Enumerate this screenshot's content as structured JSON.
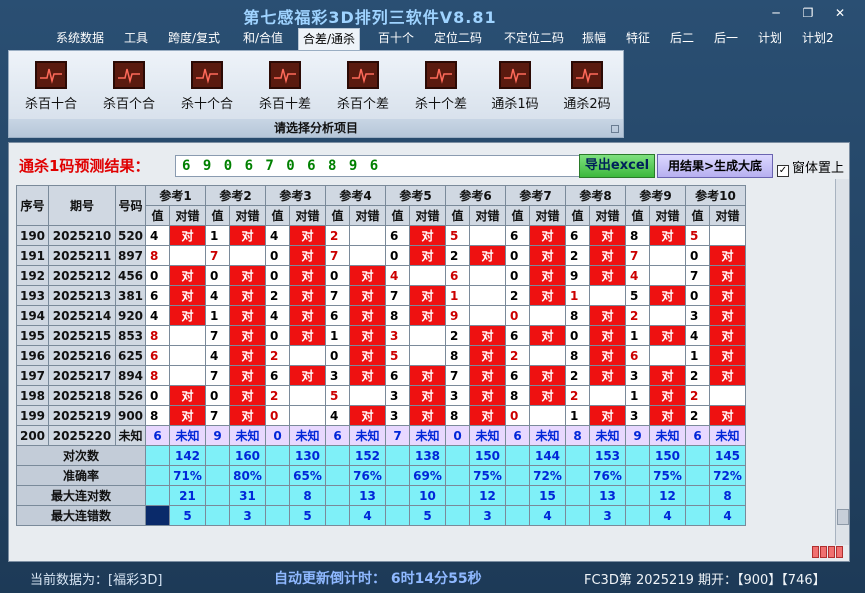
{
  "window": {
    "title": "第七感福彩3D排列三软件V8.81",
    "min": "─",
    "restore": "❐",
    "close": "✕"
  },
  "menu": [
    "系统数据",
    "工具",
    "跨度/复式",
    "和/合值",
    "合差/通杀",
    "百十个",
    "定位二码",
    "不定位二码",
    "振幅",
    "特征",
    "后二",
    "后一",
    "计划",
    "计划2"
  ],
  "menu_active": 4,
  "ribbon": {
    "buttons": [
      "杀百十合",
      "杀百个合",
      "杀十个合",
      "杀百十差",
      "杀百个差",
      "杀十个差",
      "通杀1码",
      "通杀2码"
    ],
    "caption": "请选择分析项目"
  },
  "prediction": {
    "label": "通杀1码预测结果：",
    "value": "6 9 0 6 7 0 6 8 9 6",
    "export_label": "导出excel",
    "generate_label": "用结果>生成大底",
    "topmost_label": "窗体置上"
  },
  "table": {
    "headers": {
      "seq": "序号",
      "period": "期号",
      "code": "号码",
      "refs": [
        "参考1",
        "参考2",
        "参考3",
        "参考4",
        "参考5",
        "参考6",
        "参考7",
        "参考8",
        "参考9",
        "参考10"
      ],
      "val": "值",
      "res": "对错"
    },
    "rows": [
      {
        "seq": "190",
        "period": "2025210",
        "code": "520",
        "vals": [
          "4",
          "1",
          "4",
          "2",
          "6",
          "5",
          "6",
          "6",
          "8",
          "5"
        ],
        "hits": [
          1,
          1,
          1,
          0,
          1,
          0,
          1,
          1,
          1,
          0
        ],
        "red": [
          0,
          0,
          0,
          1,
          0,
          1,
          0,
          0,
          0,
          1
        ]
      },
      {
        "seq": "191",
        "period": "2025211",
        "code": "897",
        "vals": [
          "8",
          "7",
          "0",
          "7",
          "0",
          "2",
          "0",
          "2",
          "7",
          "0"
        ],
        "hits": [
          0,
          0,
          1,
          0,
          1,
          1,
          1,
          1,
          0,
          1
        ],
        "red": [
          1,
          1,
          0,
          1,
          0,
          0,
          0,
          0,
          1,
          0
        ]
      },
      {
        "seq": "192",
        "period": "2025212",
        "code": "456",
        "vals": [
          "0",
          "0",
          "0",
          "0",
          "4",
          "6",
          "0",
          "9",
          "4",
          "7"
        ],
        "hits": [
          1,
          1,
          1,
          1,
          0,
          0,
          1,
          1,
          0,
          1
        ],
        "red": [
          0,
          0,
          0,
          0,
          1,
          1,
          0,
          0,
          1,
          0
        ]
      },
      {
        "seq": "193",
        "period": "2025213",
        "code": "381",
        "vals": [
          "6",
          "4",
          "2",
          "7",
          "7",
          "1",
          "2",
          "1",
          "5",
          "0"
        ],
        "hits": [
          1,
          1,
          1,
          1,
          1,
          0,
          1,
          0,
          1,
          1
        ],
        "red": [
          0,
          0,
          0,
          0,
          0,
          1,
          0,
          1,
          0,
          0
        ]
      },
      {
        "seq": "194",
        "period": "2025214",
        "code": "920",
        "vals": [
          "4",
          "1",
          "4",
          "6",
          "8",
          "9",
          "0",
          "8",
          "2",
          "3"
        ],
        "hits": [
          1,
          1,
          1,
          1,
          1,
          0,
          0,
          1,
          0,
          1
        ],
        "red": [
          0,
          0,
          0,
          0,
          0,
          1,
          1,
          0,
          1,
          0
        ]
      },
      {
        "seq": "195",
        "period": "2025215",
        "code": "853",
        "vals": [
          "8",
          "7",
          "0",
          "1",
          "3",
          "2",
          "6",
          "0",
          "1",
          "4"
        ],
        "hits": [
          0,
          1,
          1,
          1,
          0,
          1,
          1,
          1,
          1,
          1
        ],
        "red": [
          1,
          0,
          0,
          0,
          1,
          0,
          0,
          0,
          0,
          0
        ]
      },
      {
        "seq": "196",
        "period": "2025216",
        "code": "625",
        "vals": [
          "6",
          "4",
          "2",
          "0",
          "5",
          "8",
          "2",
          "8",
          "6",
          "1"
        ],
        "hits": [
          0,
          1,
          0,
          1,
          0,
          1,
          0,
          1,
          0,
          1
        ],
        "red": [
          1,
          0,
          1,
          0,
          1,
          0,
          1,
          0,
          1,
          0
        ]
      },
      {
        "seq": "197",
        "period": "2025217",
        "code": "894",
        "vals": [
          "8",
          "7",
          "6",
          "3",
          "6",
          "7",
          "6",
          "2",
          "3",
          "2"
        ],
        "hits": [
          0,
          1,
          1,
          1,
          1,
          1,
          1,
          1,
          1,
          1
        ],
        "red": [
          1,
          0,
          0,
          0,
          0,
          0,
          0,
          0,
          0,
          0
        ]
      },
      {
        "seq": "198",
        "period": "2025218",
        "code": "526",
        "vals": [
          "0",
          "0",
          "2",
          "5",
          "3",
          "3",
          "8",
          "2",
          "1",
          "2"
        ],
        "hits": [
          1,
          1,
          0,
          0,
          1,
          1,
          1,
          0,
          1,
          0
        ],
        "red": [
          0,
          0,
          1,
          1,
          0,
          0,
          0,
          1,
          0,
          1
        ]
      },
      {
        "seq": "199",
        "period": "2025219",
        "code": "900",
        "vals": [
          "8",
          "7",
          "0",
          "4",
          "3",
          "8",
          "0",
          "1",
          "3",
          "2"
        ],
        "hits": [
          1,
          1,
          0,
          1,
          1,
          1,
          0,
          1,
          1,
          1
        ],
        "red": [
          0,
          0,
          1,
          0,
          0,
          0,
          1,
          0,
          0,
          0
        ]
      }
    ],
    "pending": {
      "seq": "200",
      "period": "2025220",
      "code": "未知",
      "vals": [
        "6",
        "9",
        "0",
        "6",
        "7",
        "0",
        "6",
        "8",
        "9",
        "6"
      ],
      "res": "未知"
    },
    "hit_text": "对",
    "stats": [
      {
        "label": "对次数",
        "values": [
          "142",
          "160",
          "130",
          "152",
          "138",
          "150",
          "144",
          "153",
          "150",
          "145"
        ]
      },
      {
        "label": "准确率",
        "values": [
          "71%",
          "80%",
          "65%",
          "76%",
          "69%",
          "75%",
          "72%",
          "76%",
          "75%",
          "72%"
        ]
      },
      {
        "label": "最大连对数",
        "values": [
          "21",
          "31",
          "8",
          "13",
          "10",
          "12",
          "15",
          "13",
          "12",
          "8"
        ]
      },
      {
        "label": "最大连错数",
        "values": [
          "5",
          "3",
          "5",
          "4",
          "5",
          "3",
          "4",
          "3",
          "4",
          "4"
        ]
      }
    ]
  },
  "status": {
    "left": "当前数据为：[福彩3D]",
    "mid": "自动更新倒计时：  6时14分55秒",
    "right": "FC3D第 2025219 期开：【900】【746】"
  },
  "colors": {
    "hit": "#ee1111",
    "stat": "#7ff0f8",
    "pending": "#e8d8ff",
    "pred": "#008000",
    "label": "#e00000"
  }
}
